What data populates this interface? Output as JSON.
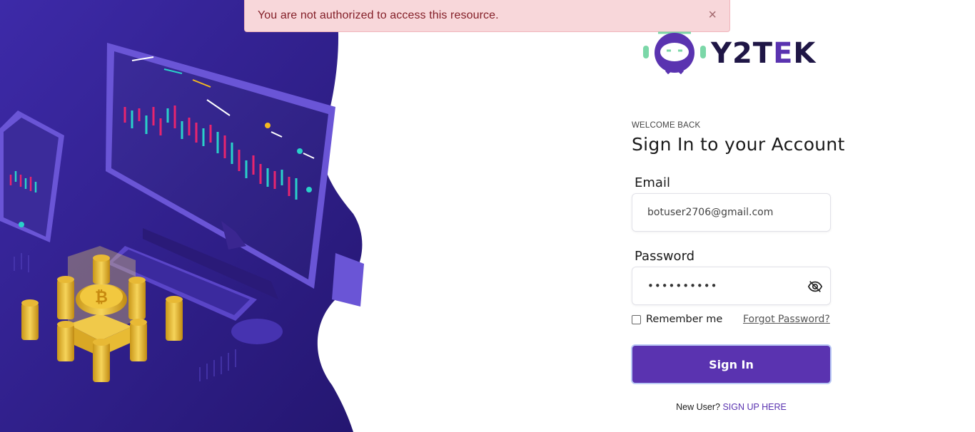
{
  "alert": {
    "message": "You are not authorized to access this resource.",
    "close_icon": "×"
  },
  "logo": {
    "brand_prefix": "Y2T",
    "brand_accent": "E",
    "brand_suffix": "K"
  },
  "form": {
    "eyebrow": "WELCOME BACK",
    "title": "Sign In to your Account",
    "email_label": "Email",
    "email_value": "botuser2706@gmail.com",
    "password_label": "Password",
    "password_value": "••••••••••",
    "remember_label": "Remember me",
    "forgot_label": "Forgot Password?",
    "submit_label": "Sign In",
    "new_user_text": "New User?",
    "signup_label": "SIGN UP HERE"
  },
  "colors": {
    "primary": "#5a33b0",
    "hero_dark": "#2d1b8a",
    "alert_bg": "#f8d7da",
    "alert_text": "#842029"
  },
  "icons": {
    "password_toggle": "eye-slash-icon",
    "alert_close": "close-icon"
  }
}
